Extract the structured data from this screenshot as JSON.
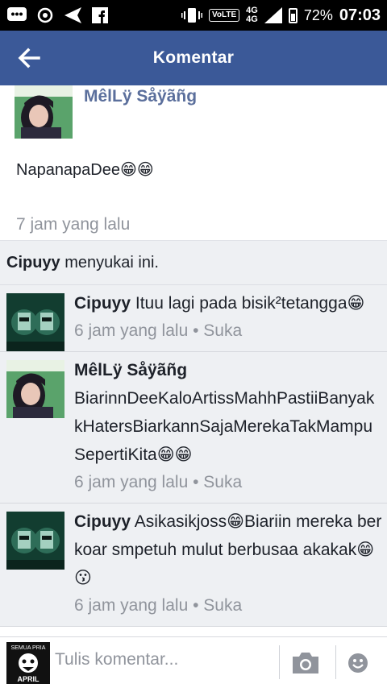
{
  "status_bar": {
    "network_top": "4G",
    "network_bottom": "4G",
    "volte": "VoLTE",
    "battery": "72%",
    "time": "07:03"
  },
  "header": {
    "title": "Komentar",
    "back_icon": "arrow-left-icon"
  },
  "post": {
    "author": "MêlLÿ Såÿãñg",
    "text": "NapanapaDee😁😁",
    "time": "7 jam yang lalu"
  },
  "likes": {
    "name": "Cipuyy",
    "suffix": " menyukai ini."
  },
  "comments": [
    {
      "author": "Cipuyy",
      "text": "Ituu lagi pada bisik²tetangga😁",
      "time": "6 jam yang lalu",
      "sep": " • ",
      "like": "Suka"
    },
    {
      "author": "MêlLÿ Såÿãñg",
      "text": "BiarinnDeeKaloArtissMahhPastiiBanyakkHatersBiarkannSajaMerekaTakMampuSepertiKita😁😁",
      "time": "6 jam yang lalu",
      "sep": " • ",
      "like": "Suka"
    },
    {
      "author": "Cipuyy",
      "text": "Asikasikjoss😁Biariin mereka berkoar smpetuh mulut berbusaa akakak😁😗",
      "time": "6 jam yang lalu",
      "sep": " • ",
      "like": "Suka"
    }
  ],
  "composer": {
    "placeholder": "Tulis komentar...",
    "avatar_text_top": "SEMUA PRIA",
    "avatar_text_bottom": "APRIL"
  },
  "colors": {
    "header": "#3b5998",
    "comment_bg": "#eef0f3",
    "meta": "#90949c",
    "name_link": "#5b6f9c"
  }
}
